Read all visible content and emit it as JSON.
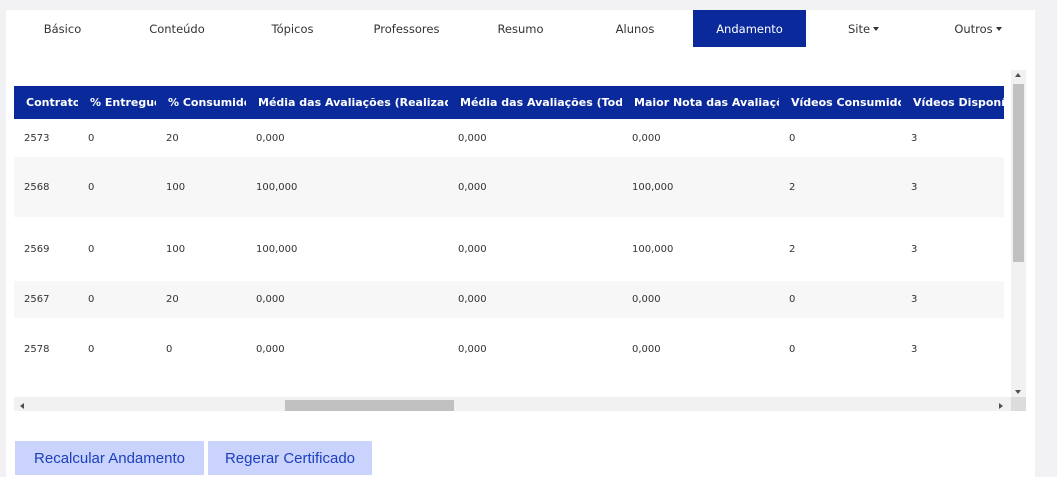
{
  "tabs": [
    {
      "label": "Básico",
      "dropdown": false,
      "active": false
    },
    {
      "label": "Conteúdo",
      "dropdown": false,
      "active": false
    },
    {
      "label": "Tópicos",
      "dropdown": false,
      "active": false
    },
    {
      "label": "Professores",
      "dropdown": false,
      "active": false
    },
    {
      "label": "Resumo",
      "dropdown": false,
      "active": false
    },
    {
      "label": "Alunos",
      "dropdown": false,
      "active": false
    },
    {
      "label": "Andamento",
      "dropdown": false,
      "active": true
    },
    {
      "label": "Site",
      "dropdown": true,
      "active": false
    },
    {
      "label": "Outros",
      "dropdown": true,
      "active": false
    }
  ],
  "table": {
    "headers": [
      "Contrato",
      "% Entregue",
      "% Consumido",
      "Média das Avaliações (Realizadas)",
      "Média das Avaliações (Todas)",
      "Maior Nota das Avaliações",
      "Vídeos Consumidos",
      "Vídeos Disponíveis"
    ],
    "rows": [
      [
        "2573",
        "0",
        "20",
        "0,000",
        "0,000",
        "0,000",
        "0",
        "3"
      ],
      [
        "2568",
        "0",
        "100",
        "100,000",
        "0,000",
        "100,000",
        "2",
        "3"
      ],
      [
        "2569",
        "0",
        "100",
        "100,000",
        "0,000",
        "100,000",
        "2",
        "3"
      ],
      [
        "2567",
        "0",
        "20",
        "0,000",
        "0,000",
        "0,000",
        "0",
        "3"
      ],
      [
        "2578",
        "0",
        "0",
        "0,000",
        "0,000",
        "0,000",
        "0",
        "3"
      ]
    ]
  },
  "actions": {
    "recalculate_label": "Recalcular Andamento",
    "regenerate_label": "Regerar Certificado"
  },
  "colors": {
    "accent": "#0a2a9c",
    "button_bg": "#c9d3fb",
    "button_text": "#1d3fbf"
  }
}
